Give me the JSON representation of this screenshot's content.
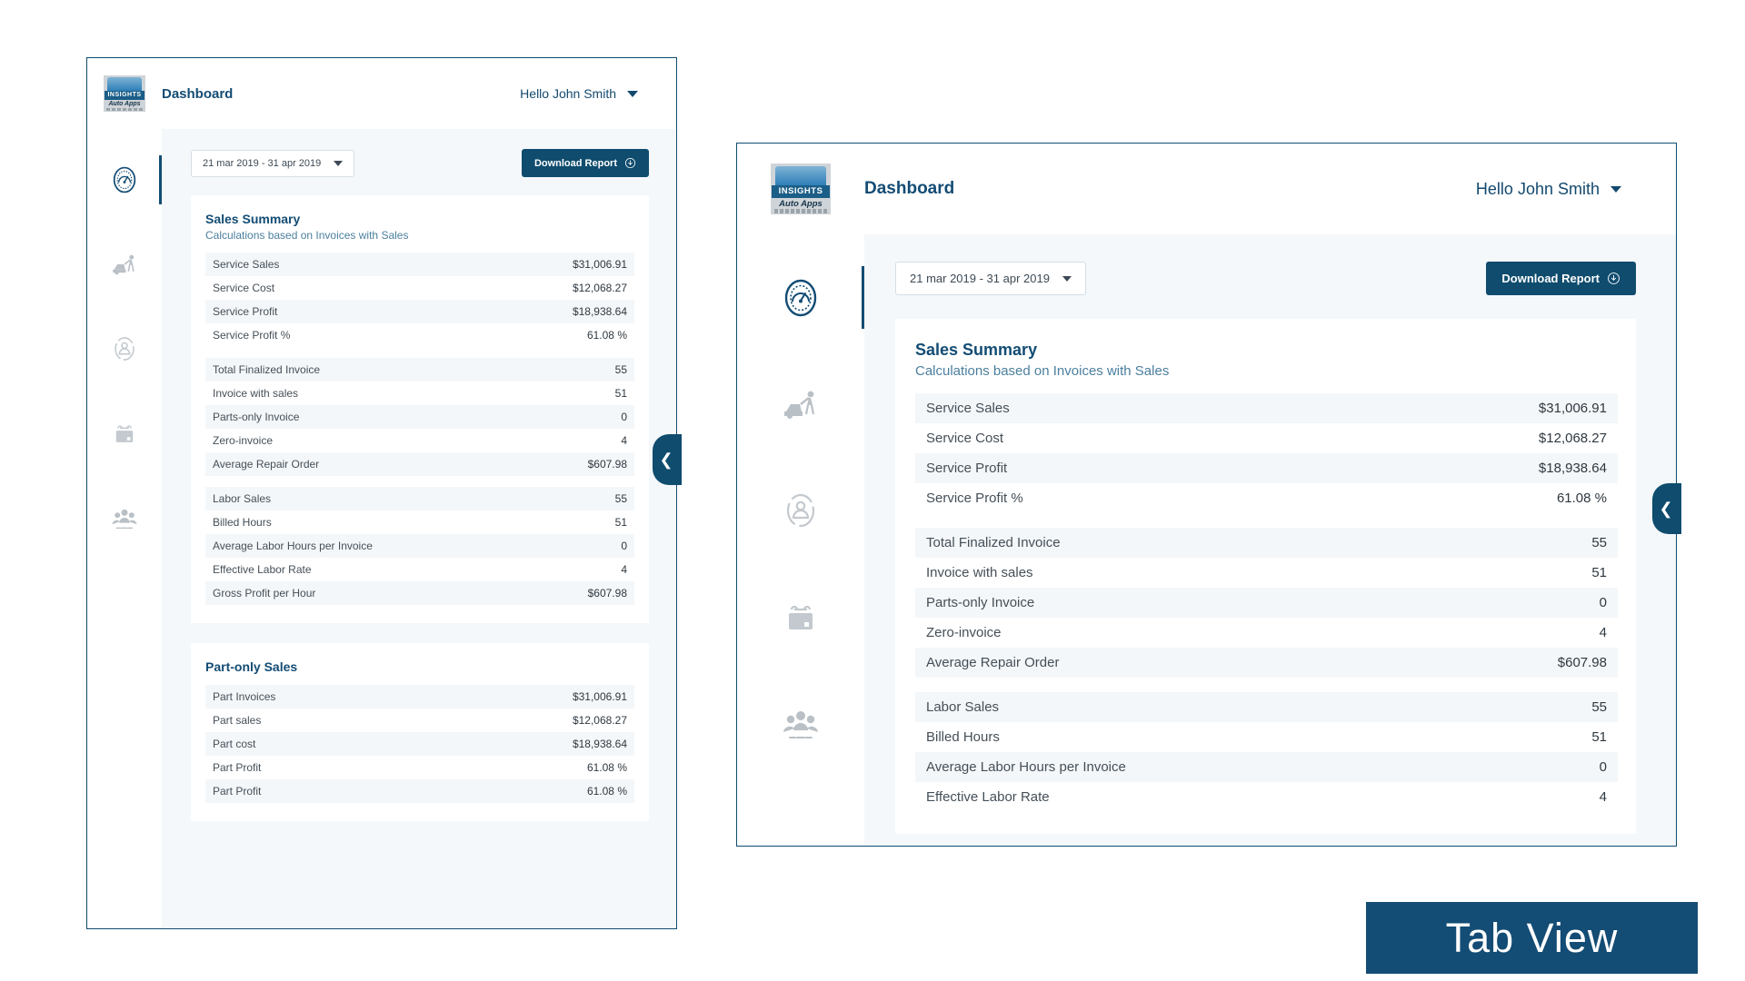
{
  "caption": "Tab View",
  "brand": {
    "logo_top": "logo-swoosh",
    "logo_mid": "INSIGHTS",
    "logo_bot": "Auto Apps",
    "accent": "#0f4c6e",
    "title_color": "#134c74",
    "row_alt_color": "#f4f7f9",
    "content_bg": "#f4f8fb"
  },
  "header": {
    "title": "Dashboard",
    "user_greeting": "Hello John Smith",
    "caret_icon": "chevron-down-icon"
  },
  "rail": {
    "items": [
      {
        "name": "dashboard",
        "icon": "gauge-icon",
        "active": true
      },
      {
        "name": "service",
        "icon": "car-repair-icon",
        "active": false
      },
      {
        "name": "customers",
        "icon": "person-badge-icon",
        "active": false
      },
      {
        "name": "appointments",
        "icon": "calendar-icon",
        "active": false
      },
      {
        "name": "team",
        "icon": "people-group-icon",
        "active": false
      }
    ]
  },
  "toolbar": {
    "date_range": "21 mar 2019 - 31 apr 2019",
    "date_caret_icon": "chevron-down-icon",
    "download_label": "Download Report",
    "download_icon": "download-cloud-icon"
  },
  "handles": {
    "collapse_icon": "chevron-left-icon",
    "label": "collapse-panel"
  },
  "sales_summary": {
    "title": "Sales Summary",
    "subtitle": "Calculations based on Invoices with Sales",
    "groups": [
      {
        "rows": [
          {
            "label": "Service Sales",
            "value": "$31,006.91"
          },
          {
            "label": "Service Cost",
            "value": "$12,068.27"
          },
          {
            "label": "Service Profit",
            "value": "$18,938.64"
          },
          {
            "label": "Service Profit %",
            "value": "61.08 %"
          }
        ]
      },
      {
        "rows": [
          {
            "label": "Total Finalized Invoice",
            "value": "55"
          },
          {
            "label": "Invoice with sales",
            "value": "51"
          },
          {
            "label": "Parts-only Invoice",
            "value": "0"
          },
          {
            "label": "Zero-invoice",
            "value": "4"
          },
          {
            "label": "Average Repair Order",
            "value": "$607.98"
          }
        ]
      },
      {
        "rows": [
          {
            "label": "Labor Sales",
            "value": "55"
          },
          {
            "label": "Billed Hours",
            "value": "51"
          },
          {
            "label": "Average Labor Hours per Invoice",
            "value": "0"
          },
          {
            "label": "Effective Labor Rate",
            "value": "4"
          },
          {
            "label": "Gross Profit per Hour",
            "value": "$607.98"
          }
        ]
      }
    ]
  },
  "sales_summary_right_visible_groups": [
    {
      "rows": [
        {
          "label": "Service Sales",
          "value": "$31,006.91"
        },
        {
          "label": "Service Cost",
          "value": "$12,068.27"
        },
        {
          "label": "Service Profit",
          "value": "$18,938.64"
        },
        {
          "label": "Service Profit %",
          "value": "61.08 %"
        }
      ]
    },
    {
      "rows": [
        {
          "label": "Total Finalized Invoice",
          "value": "55"
        },
        {
          "label": "Invoice with sales",
          "value": "51"
        },
        {
          "label": "Parts-only Invoice",
          "value": "0"
        },
        {
          "label": "Zero-invoice",
          "value": "4"
        },
        {
          "label": "Average Repair Order",
          "value": "$607.98"
        }
      ]
    },
    {
      "rows": [
        {
          "label": "Labor Sales",
          "value": "55"
        },
        {
          "label": "Billed Hours",
          "value": "51"
        },
        {
          "label": "Average Labor Hours per Invoice",
          "value": "0"
        },
        {
          "label": "Effective Labor Rate",
          "value": "4"
        }
      ]
    }
  ],
  "part_only_sales": {
    "title": "Part-only Sales",
    "rows": [
      {
        "label": "Part Invoices",
        "value": "$31,006.91"
      },
      {
        "label": "Part sales",
        "value": "$12,068.27"
      },
      {
        "label": "Part cost",
        "value": "$18,938.64"
      },
      {
        "label": "Part Profit",
        "value": "61.08 %"
      },
      {
        "label": "Part Profit",
        "value": "61.08 %"
      }
    ]
  }
}
